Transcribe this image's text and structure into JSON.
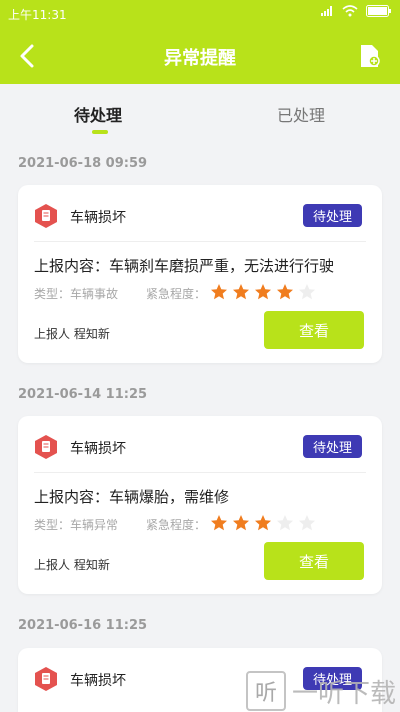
{
  "status_bar": {
    "time": "上午11:31"
  },
  "header": {
    "title": "异常提醒"
  },
  "tabs": [
    {
      "label": "待处理",
      "active": true
    },
    {
      "label": "已处理",
      "active": false
    }
  ],
  "records": [
    {
      "date": "2021-06-18 09:59",
      "title": "车辆损坏",
      "status": "待处理",
      "content": "上报内容：车辆刹车磨损严重，无法进行行驶",
      "type_label": "类型：车辆事故",
      "urgency_label": "紧急程度：",
      "urgency_stars": 4,
      "max_stars": 5,
      "reporter": "上报人 程知新",
      "action_label": "查看"
    },
    {
      "date": "2021-06-14 11:25",
      "title": "车辆损坏",
      "status": "待处理",
      "content": "上报内容：车辆爆胎，需维修",
      "type_label": "类型：车辆异常",
      "urgency_label": "紧急程度：",
      "urgency_stars": 3,
      "max_stars": 5,
      "reporter": "上报人 程知新",
      "action_label": "查看"
    },
    {
      "date": "2021-06-16 11:25",
      "title": "车辆损坏",
      "status": "待处理"
    }
  ],
  "watermark": {
    "char": "听",
    "text": "一听下载"
  },
  "colors": {
    "accent": "#b8e21a",
    "badge": "#3e3ab4",
    "star_on": "#f07d1f",
    "star_off": "#eeeeee",
    "icon_red": "#e4524f"
  }
}
